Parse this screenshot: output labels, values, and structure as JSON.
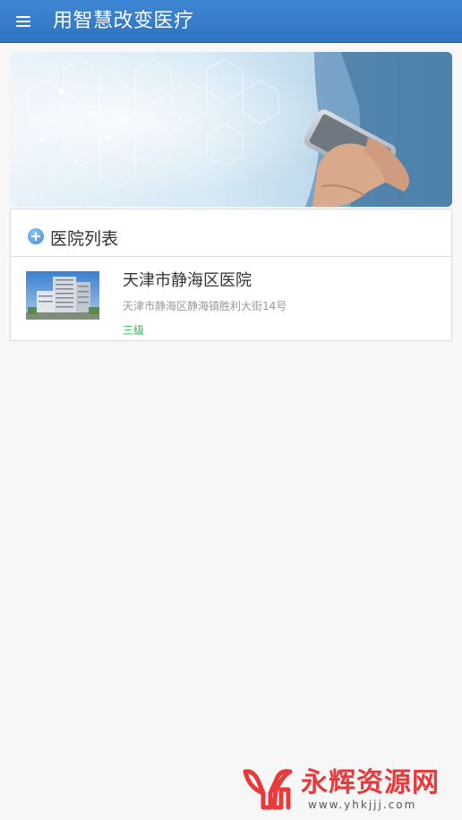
{
  "header": {
    "title": "用智慧改变医疗",
    "menu_icon": "hamburger-menu-icon"
  },
  "banner": {
    "description_icon": "phone-in-hand-banner"
  },
  "section": {
    "title": "医院列表",
    "icon": "plus-circle-icon"
  },
  "hospitals": [
    {
      "name": "天津市静海区医院",
      "address": "天津市静海区静海镇胜利大街14号",
      "level": "三级"
    }
  ],
  "watermark": {
    "brand": "永辉资源网",
    "url": "www.yhkjjj.com"
  },
  "colors": {
    "header_bg": "#3579c9",
    "level_green": "#2fb84f",
    "watermark_red": "#e83a3a"
  }
}
